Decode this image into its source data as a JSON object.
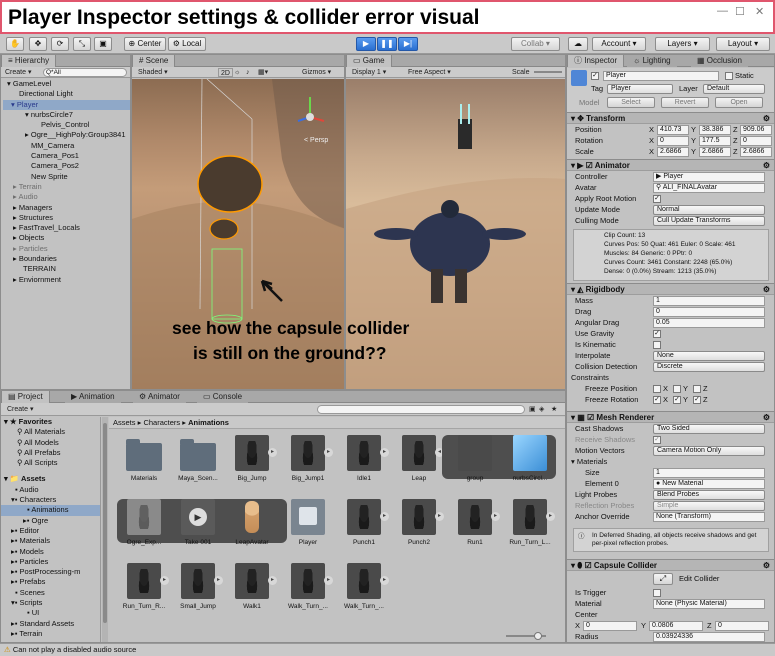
{
  "window": {
    "title": "Player Inspector settings & collider error visual"
  },
  "toolbar": {
    "center": "Center",
    "local": "Local",
    "collab": "Collab ▾",
    "account": "Account",
    "layers": "Layers",
    "layout": "Layout"
  },
  "hierarchy": {
    "tab": "Hierarchy",
    "create": "Create ▾",
    "search": "Q*All",
    "items": [
      {
        "label": "GameLevel",
        "indent": 0
      },
      {
        "label": "Directional Light",
        "indent": 1
      },
      {
        "label": "Player",
        "indent": 1
      },
      {
        "label": "nurbsCircle7",
        "indent": 2
      },
      {
        "label": "Pelvis_Control",
        "indent": 3
      },
      {
        "label": "Ogre__HighPoly:Group3841",
        "indent": 2
      },
      {
        "label": "MM_Camera",
        "indent": 2
      },
      {
        "label": "Camera_Pos1",
        "indent": 2
      },
      {
        "label": "Camera_Pos2",
        "indent": 2
      },
      {
        "label": "New Sprite",
        "indent": 2
      },
      {
        "label": "Terrain",
        "indent": 1
      },
      {
        "label": "Audio",
        "indent": 1
      },
      {
        "label": "Managers",
        "indent": 1
      },
      {
        "label": "Structures",
        "indent": 1
      },
      {
        "label": "FastTravel_Locals",
        "indent": 1
      },
      {
        "label": "Objects",
        "indent": 1
      },
      {
        "label": "Particles",
        "indent": 1
      },
      {
        "label": "Boundaries",
        "indent": 1
      },
      {
        "label": "TERRAIN",
        "indent": 1
      },
      {
        "label": "Enviornment",
        "indent": 1
      }
    ]
  },
  "scene": {
    "tab": "Scene",
    "shading": "Shaded",
    "mode2d": "2D",
    "gizmos": "Gizmos ▾",
    "persp": "< Persp"
  },
  "game": {
    "tab": "Game",
    "display": "Display 1",
    "aspect": "Free Aspect",
    "scale": "Scale"
  },
  "annotation": {
    "line1": "see how the capsule collider",
    "line2": "is still on the ground??"
  },
  "project": {
    "tabs": [
      "Project",
      "Animation",
      "Animator",
      "Console"
    ],
    "create": "Create ▾",
    "breadcrumb": [
      "Assets",
      "Characters",
      "Animations"
    ],
    "favorites": {
      "label": "Favorites",
      "items": [
        "All Materials",
        "All Models",
        "All Prefabs",
        "All Scripts"
      ]
    },
    "assets_tree": {
      "label": "Assets",
      "items": [
        "Audio",
        "Characters",
        "Animations",
        "Ogre",
        "Editor",
        "Materials",
        "Models",
        "Particles",
        "PostProcessing-m",
        "Prefabs",
        "Scenes",
        "Scripts",
        "UI",
        "Standard Assets",
        "Terrain"
      ]
    },
    "row1": [
      "Materials",
      "Maya_Scen...",
      "Big_Jump",
      "Big_Jump1",
      "Idle1",
      "Leap",
      "group",
      "nurbsCircl..."
    ],
    "row2": [
      "Ogre_Exp...",
      "Take 001",
      "LeapAvatar",
      "Player",
      "Punch1",
      "Punch2",
      "Run1",
      "Run_Turn_L..."
    ],
    "row3": [
      "Run_Turn_R...",
      "Small_Jump",
      "Walk1",
      "Walk_Turn_...",
      "Walk_Turn_..."
    ]
  },
  "inspector": {
    "tabs": [
      "Inspector",
      "Lighting",
      "Occlusion"
    ],
    "name": "Player",
    "static": "Static",
    "tag_label": "Tag",
    "tag": "Player",
    "layer_label": "Layer",
    "layer": "Default",
    "model_buttons": [
      "Model",
      "Select",
      "Revert",
      "Open"
    ],
    "transform": {
      "title": "Transform",
      "rows": [
        {
          "label": "Position",
          "x": "410.73",
          "y": "38.386",
          "z": "909.06"
        },
        {
          "label": "Rotation",
          "x": "0",
          "y": "177.5",
          "z": "0"
        },
        {
          "label": "Scale",
          "x": "2.6866",
          "y": "2.6866",
          "z": "2.6866"
        }
      ]
    },
    "animator": {
      "title": "Animator",
      "controller_label": "Controller",
      "controller": "Player",
      "avatar_label": "Avatar",
      "avatar": "ALI_FINALAvatar",
      "root_motion_label": "Apply Root Motion",
      "update_mode_label": "Update Mode",
      "update_mode": "Normal",
      "culling_label": "Culling Mode",
      "culling": "Cull Update Transforms",
      "info": [
        "Clip Count: 13",
        "Curves Pos: 50 Quat: 461 Euler: 0 Scale: 461",
        "Muscles: 84 Generic: 0 PPtr: 0",
        "Curves Count: 3461 Constant: 2248 (65.0%)",
        "Dense: 0 (0.0%) Stream: 1213 (35.0%)"
      ]
    },
    "rigidbody": {
      "title": "Rigidbody",
      "mass_label": "Mass",
      "mass": "1",
      "drag_label": "Drag",
      "drag": "0",
      "angular_label": "Angular Drag",
      "angular": "0.05",
      "gravity_label": "Use Gravity",
      "kinematic_label": "Is Kinematic",
      "interpolate_label": "Interpolate",
      "interpolate": "None",
      "collision_label": "Collision Detection",
      "collision": "Discrete",
      "constraints_label": "Constraints",
      "freeze_pos_label": "Freeze Position",
      "freeze_rot_label": "Freeze Rotation",
      "axes": [
        "X",
        "Y",
        "Z"
      ]
    },
    "mesh_renderer": {
      "title": "Mesh Renderer",
      "cast_label": "Cast Shadows",
      "cast": "Two Sided",
      "receive_label": "Receive Shadows",
      "motion_label": "Motion Vectors",
      "motion": "Camera Motion Only",
      "materials_label": "Materials",
      "size_label": "Size",
      "size": "1",
      "element_label": "Element 0",
      "element": "New Material",
      "light_probes_label": "Light Probes",
      "light_probes": "Blend Probes",
      "reflection_label": "Reflection Probes",
      "reflection": "Simple",
      "anchor_label": "Anchor Override",
      "anchor": "None (Transform)",
      "note": "In Deferred Shading, all objects receive shadows and get per-pixel reflection probes."
    },
    "capsule": {
      "title": "Capsule Collider",
      "edit_label": "Edit Collider",
      "trigger_label": "Is Trigger",
      "material_label": "Material",
      "material": "None (Physic Material)",
      "center_label": "Center",
      "cx": "0",
      "cy": "0.0806",
      "cz": "0",
      "radius_label": "Radius",
      "radius": "0.03924336"
    }
  },
  "status": {
    "message": "Can not play a disabled audio source"
  }
}
